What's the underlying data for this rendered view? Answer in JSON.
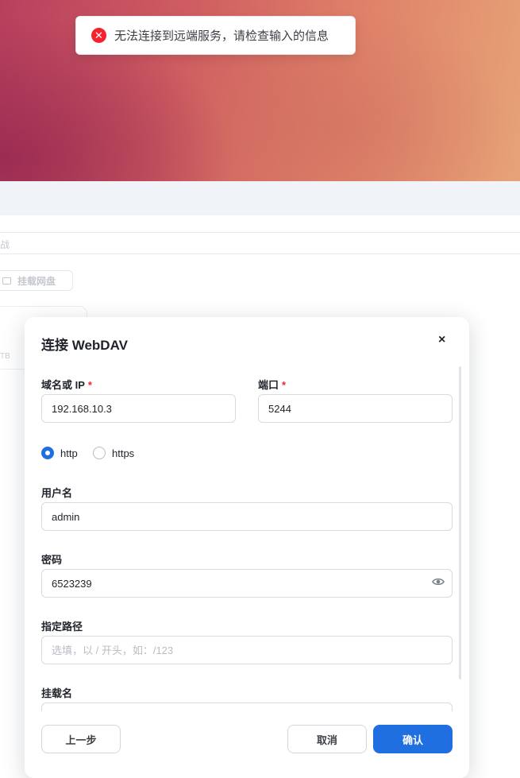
{
  "toast": {
    "message": "无法连接到远端服务，请检查输入的信息",
    "icon": "close-circle-icon",
    "color": "#f5222d"
  },
  "background": {
    "fragment": "战",
    "mount_button": "挂载网盘",
    "storage_fragment": "TB"
  },
  "dialog": {
    "title": "连接 WebDAV",
    "close": "×",
    "host": {
      "label": "域名或 IP",
      "required_mark": "*",
      "value": "192.168.10.3"
    },
    "port": {
      "label": "端口",
      "required_mark": "*",
      "value": "5244"
    },
    "protocol": {
      "options": [
        "http",
        "https"
      ],
      "selected": "http"
    },
    "username": {
      "label": "用户名",
      "value": "admin"
    },
    "password": {
      "label": "密码",
      "value": "6523239",
      "toggle_icon": "eye-icon"
    },
    "path": {
      "label": "指定路径",
      "value": "",
      "placeholder": "选填，以 / 开头，如：/123"
    },
    "mount_name": {
      "label": "挂载名",
      "value": ""
    },
    "buttons": {
      "back": "上一步",
      "cancel": "取消",
      "confirm": "确认"
    }
  },
  "colors": {
    "primary": "#1f6fe0",
    "error": "#f5222d"
  }
}
